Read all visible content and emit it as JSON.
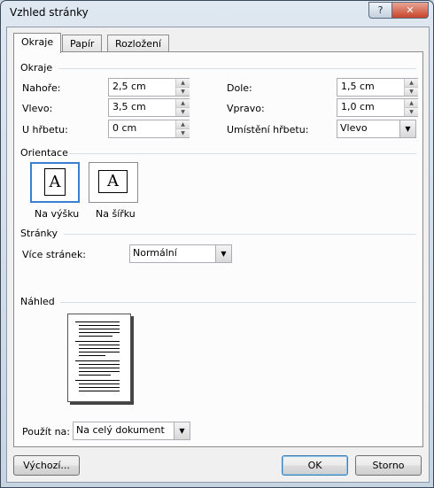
{
  "window": {
    "title": "Vzhled stránky",
    "help_label": "?",
    "close_label": "✕"
  },
  "tabs": [
    {
      "label": "Okraje",
      "active": true
    },
    {
      "label": "Papír",
      "active": false
    },
    {
      "label": "Rozložení",
      "active": false
    }
  ],
  "margins": {
    "section_label": "Okraje",
    "top": {
      "label": "Nahoře:",
      "value": "2,5 cm"
    },
    "bottom": {
      "label": "Dole:",
      "value": "1,5 cm"
    },
    "left": {
      "label": "Vlevo:",
      "value": "3,5 cm"
    },
    "right": {
      "label": "Vpravo:",
      "value": "1,0 cm"
    },
    "gutter": {
      "label": "U hřbetu:",
      "value": "0 cm"
    },
    "gutter_position": {
      "label": "Umístění hřbetu:",
      "value": "Vlevo"
    }
  },
  "orientation": {
    "section_label": "Orientace",
    "portrait": {
      "label": "Na výšku",
      "glyph": "A",
      "selected": true
    },
    "landscape": {
      "label": "Na šířku",
      "glyph": "A",
      "selected": false
    }
  },
  "pages": {
    "section_label": "Stránky",
    "multiple_pages": {
      "label": "Více stránek:",
      "value": "Normální"
    }
  },
  "preview": {
    "section_label": "Náhled"
  },
  "apply_to": {
    "label": "Použít na:",
    "value": "Na celý dokument"
  },
  "buttons": {
    "default_label": "Výchozí...",
    "ok_label": "OK",
    "cancel_label": "Storno"
  },
  "icons": {
    "spin_up": "▲",
    "spin_down": "▼",
    "dropdown": "▼"
  }
}
